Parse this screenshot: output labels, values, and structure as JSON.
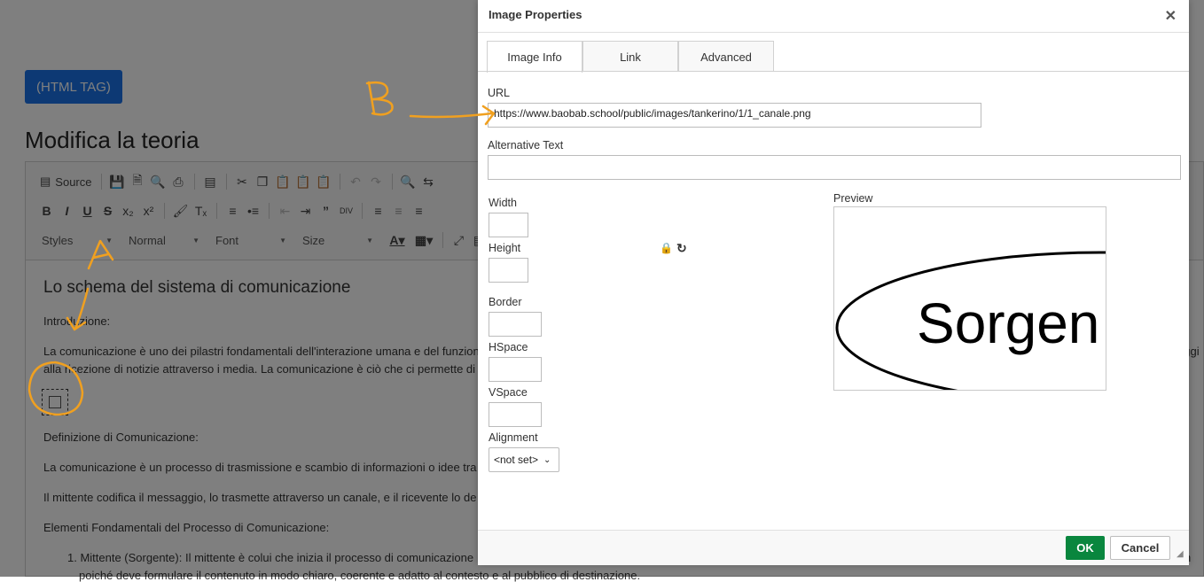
{
  "page": {
    "html_tag_button": "(HTML TAG)",
    "title": "Modifica la teoria"
  },
  "editor": {
    "toolbar": {
      "source_label": "Source",
      "styles_label": "Styles",
      "format_label": "Normal",
      "font_label": "Font",
      "size_label": "Size"
    },
    "content": {
      "heading": "Lo schema del sistema di comunicazione",
      "p1": "Introduzione:",
      "p2": "La comunicazione è uno dei pilastri fondamentali dell'interazione umana e del funzione",
      "p2b": "alla ricezione di notizie attraverso i media. La comunicazione è ciò che ci permette di",
      "p2_overflow": "aggi",
      "p3": "Definizione di Comunicazione:",
      "p4": "La comunicazione è un processo di trasmissione e scambio di informazioni o idee tra",
      "p5": "Il mittente codifica il messaggio, lo trasmette attraverso un canale, e il ricevente lo de",
      "p6": "Elementi Fondamentali del Processo di Comunicazione:",
      "li1": "1. Mittente (Sorgente): Il mittente è colui che inizia il processo di comunicazione",
      "li1b": "poiché deve formulare il contenuto in modo chiaro, coerente e adatto al contesto e al pubblico di destinazione.",
      "li1_overflow": "rm"
    }
  },
  "dialog": {
    "title": "Image Properties",
    "tabs": [
      "Image Info",
      "Link",
      "Advanced"
    ],
    "url_label": "URL",
    "url_value": "https://www.baobab.school/public/images/tankerino/1/1_canale.png",
    "alt_label": "Alternative Text",
    "alt_value": "",
    "width_label": "Width",
    "height_label": "Height",
    "border_label": "Border",
    "hspace_label": "HSpace",
    "vspace_label": "VSpace",
    "alignment_label": "Alignment",
    "alignment_value": "<not set>",
    "preview_label": "Preview",
    "preview_text": "Sorgen",
    "ok_label": "OK",
    "cancel_label": "Cancel"
  },
  "annotations": {
    "letter_a": "A",
    "letter_b": "B",
    "color": "#f0a020"
  }
}
